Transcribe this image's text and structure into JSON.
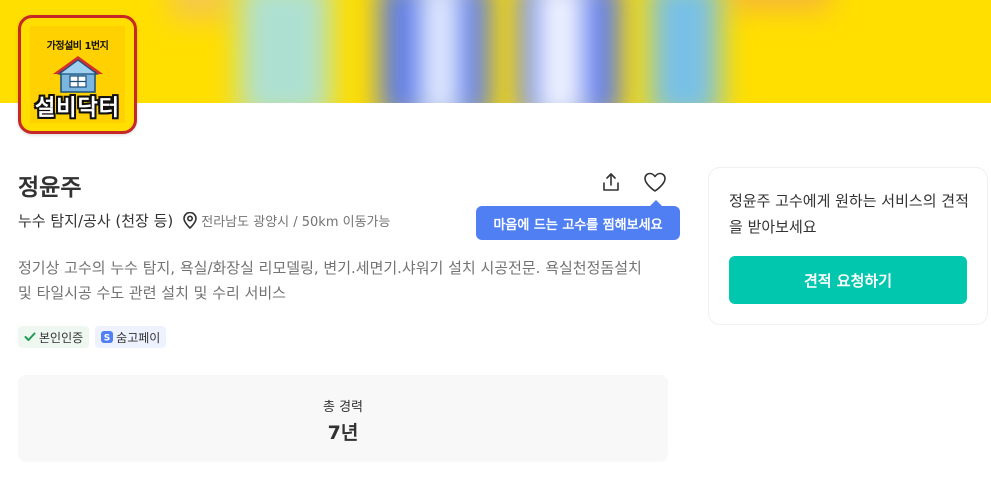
{
  "profile": {
    "logo_tagline": "가정설비 1번지",
    "logo_brand": "설비닥터",
    "name": "정윤주",
    "service": "누수 탐지/공사 (천장 등)",
    "location": "전라남도 광양시 / 50km 이동가능",
    "description": "정기상 고수의 누수 탐지, 욕실/화장실 리모델링, 변기.세면기.샤워기 설치 시공전문. 욕실천정돔설치 및 타일시공 수도 관련 설치 및 수리 서비스",
    "badges": [
      {
        "label": "본인인증",
        "icon": "check-icon"
      },
      {
        "label": "숨고페이",
        "icon": "pay-icon"
      }
    ],
    "career_label": "총 경력",
    "career_value": "7년"
  },
  "actions": {
    "share_icon": "share-icon",
    "heart_icon": "heart-icon",
    "tooltip": "마음에 드는 고수를 찜해보세요"
  },
  "quote": {
    "text": "정윤주 고수에게 원하는 서비스의 견적을 받아보세요",
    "button_label": "견적 요청하기"
  },
  "colors": {
    "banner": "#ffdf00",
    "tooltip": "#4f7ff2",
    "cta": "#00c7ae",
    "logo_border": "#c62828"
  }
}
